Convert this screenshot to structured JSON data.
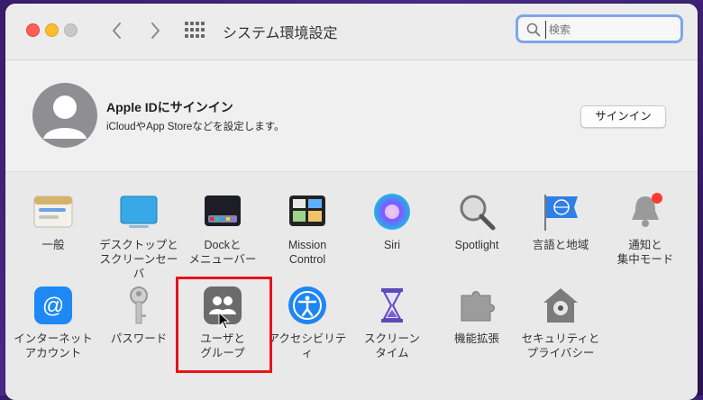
{
  "window": {
    "title": "システム環境設定",
    "nav_back": "‹",
    "nav_forward": "›"
  },
  "search": {
    "placeholder": "検索",
    "value": ""
  },
  "account": {
    "title": "Apple IDにサインイン",
    "subtitle": "iCloudやApp Storeなどを設定します。",
    "signin_label": "サインイン"
  },
  "prefs": [
    {
      "label": "一般",
      "icon": "general-icon"
    },
    {
      "label": "デスクトップと\nスクリーンセーバ",
      "icon": "desktop-icon"
    },
    {
      "label": "Dockと\nメニューバー",
      "icon": "dock-icon"
    },
    {
      "label": "Mission\nControl",
      "icon": "mission-control-icon"
    },
    {
      "label": "Siri",
      "icon": "siri-icon"
    },
    {
      "label": "Spotlight",
      "icon": "spotlight-icon"
    },
    {
      "label": "言語と地域",
      "icon": "language-region-icon"
    },
    {
      "label": "通知と\n集中モード",
      "icon": "notifications-icon"
    },
    {
      "label": "インターネット\nアカウント",
      "icon": "internet-accounts-icon"
    },
    {
      "label": "パスワード",
      "icon": "passwords-icon"
    },
    {
      "label": "ユーザと\nグループ",
      "icon": "users-groups-icon"
    },
    {
      "label": "アクセシビリティ",
      "icon": "accessibility-icon"
    },
    {
      "label": "スクリーン\nタイム",
      "icon": "screen-time-icon"
    },
    {
      "label": "機能拡張",
      "icon": "extensions-icon"
    },
    {
      "label": "セキュリティと\nプライバシー",
      "icon": "security-privacy-icon"
    }
  ],
  "colors": {
    "highlight": "#e8121b",
    "search_focus": "#7fa6e8"
  }
}
